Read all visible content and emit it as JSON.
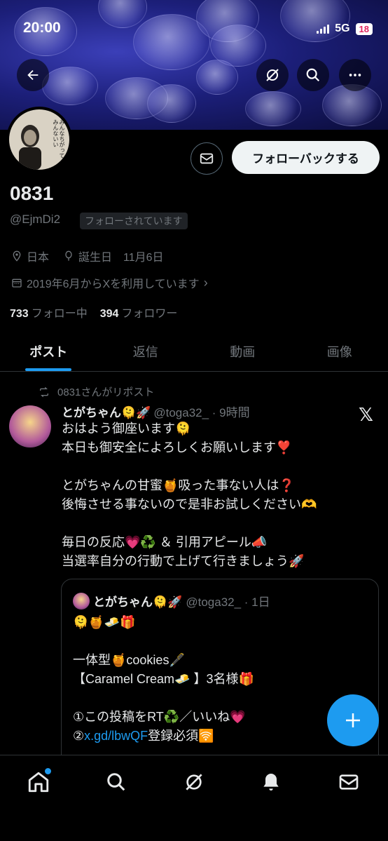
{
  "status_bar": {
    "time": "20:00",
    "network": "5G",
    "battery": "18"
  },
  "header": {
    "back_icon": "arrow-left-icon",
    "grok_icon": "grok-icon",
    "search_icon": "search-icon",
    "more_icon": "more-icon"
  },
  "profile": {
    "avatar_text": "みんなちがって\nみんないい",
    "display_name": "0831",
    "handle": "@EjmDi2",
    "follows_you": "フォローされています",
    "location": "日本",
    "birthday": "誕生日　11月6日",
    "joined": "2019年6月からXを利用しています",
    "following_count": "733",
    "following_label": "フォロー中",
    "followers_count": "394",
    "followers_label": "フォロワー"
  },
  "actions": {
    "follow_back": "フォローバックする"
  },
  "tabs": [
    {
      "label": "ポスト",
      "active": true
    },
    {
      "label": "返信",
      "active": false
    },
    {
      "label": "動画",
      "active": false
    },
    {
      "label": "画像",
      "active": false
    }
  ],
  "tweet": {
    "repost_label": "0831さんがリポスト",
    "display_name": "とがちゃん🫠🚀",
    "handle_time": "@toga32_ · 9時間",
    "body": "おはよう御座います🫠\n本日も御安全によろしくお願いします❣️\n\nとがちゃんの甘蜜🍯吸った事ない人は❓\n後悔させる事ないので是非お試しください🫶\n\n毎日の反応💗♻️ ＆ 引用アピール📣\n当選率自分の行動で上げて行きましょう🚀",
    "quote": {
      "display_name": "とがちゃん🫠🚀",
      "handle_time": "@toga32_ · 1日",
      "body_pre": "🫠🍯🧈🎁\n\n一体型🍯cookies🖋️\n【Caramel Cream🧈 】3名様🎁\n\n①この投稿をRT♻️／いいね💗\n②",
      "link": "x.gd/lbwQF",
      "body_post": "登録必須🛜"
    }
  },
  "colors": {
    "accent": "#1d9bf0",
    "background": "#000000",
    "muted": "#71767b"
  }
}
